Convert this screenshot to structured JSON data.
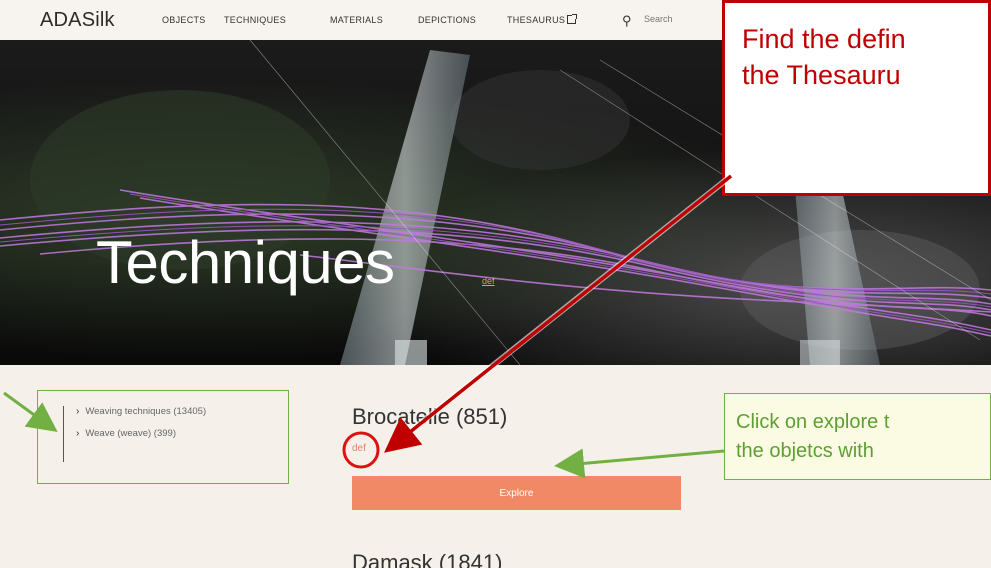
{
  "nav": {
    "brand": "ADASilk",
    "links": [
      "OBJECTS",
      "TECHNIQUES",
      "MATERIALS",
      "DEPICTIONS",
      "THESAURUS"
    ],
    "search_placeholder": "Search"
  },
  "hero": {
    "title": "Techniques",
    "def_link": "def"
  },
  "sidebar": {
    "items": [
      {
        "label": "Weaving techniques (13405)"
      },
      {
        "label": "Weave (weave) (399)"
      }
    ]
  },
  "main": {
    "term_title": "Brocatelle (851)",
    "def_link": "def",
    "explore_label": "Explore",
    "next_term_title": "Damask (1841)"
  },
  "annotations": {
    "red_callout_lines": [
      "Find the defin",
      "the Thesauru"
    ],
    "green_callout_lines": [
      "Click on explore t",
      "the objetcs with"
    ],
    "red_color": "#c00000",
    "green_color": "#72b043"
  },
  "icons": {
    "search": "search-icon",
    "external": "external-link-icon",
    "chevron": "chevron-right-icon"
  }
}
